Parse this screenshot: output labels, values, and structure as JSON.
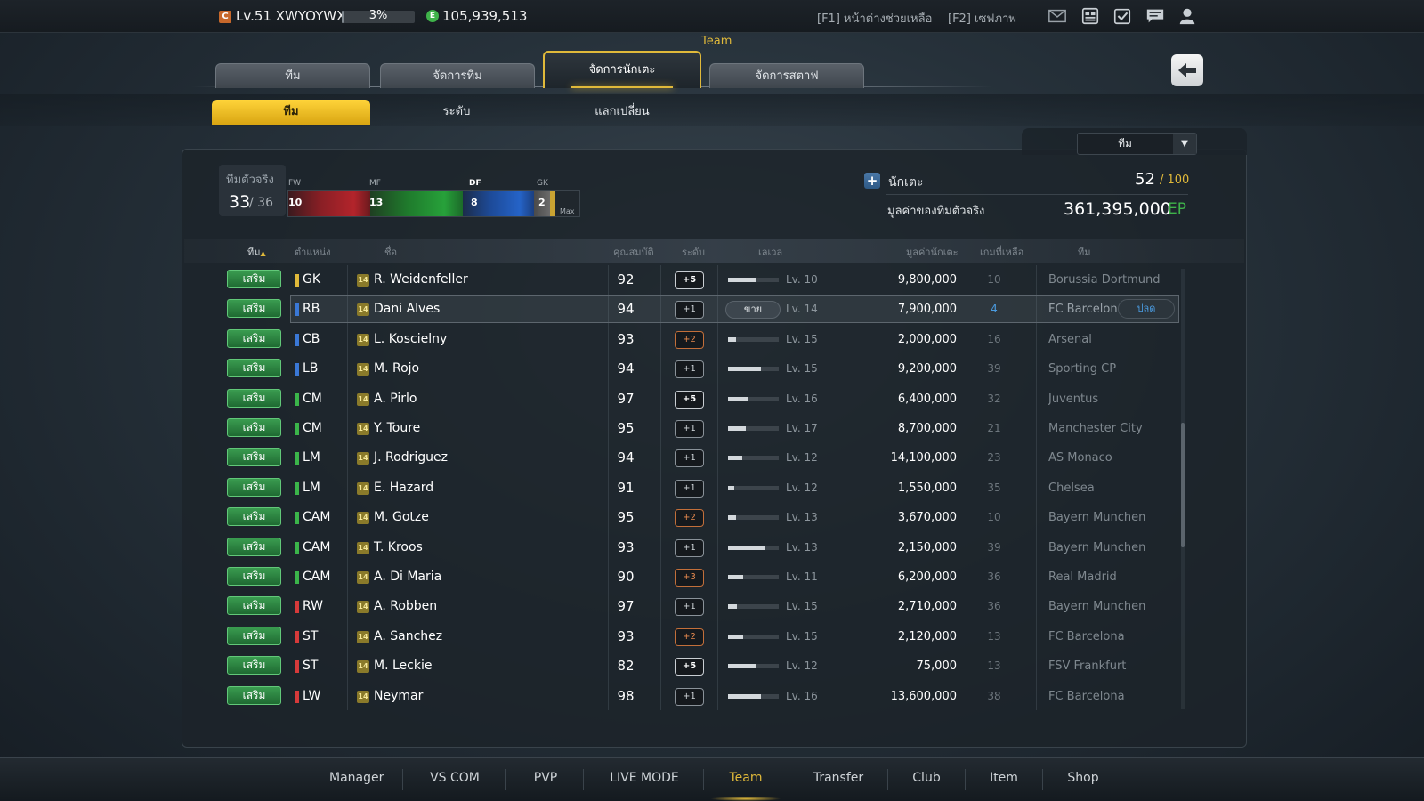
{
  "topbar": {
    "level_icon": "C",
    "level_text": "Lv.51 XWYOYWX",
    "exp_percent": "3%",
    "exp_fraction": 0.03,
    "ep_icon": "E",
    "ep_amount": "105,939,513",
    "help_text": "[F1] หน้าต่างช่วยเหลือ",
    "save_text": "[F2] เซฟภาพ",
    "icons": [
      "mail-icon",
      "card-icon",
      "checklist-icon",
      "message-icon",
      "user-icon"
    ]
  },
  "section_title": "Team",
  "main_tabs": [
    "ทีม",
    "จัดการทีม",
    "จัดการนักเตะ",
    "จัดการสตาฟ"
  ],
  "active_main_tab": "จัดการนักเตะ",
  "sub_tabs": [
    "ทีม",
    "ระดับ",
    "แลกเปลี่ยน"
  ],
  "active_sub_tab": "ทีม",
  "filter": {
    "selected": "ทีม"
  },
  "real_team": {
    "label": "ทีมตัวจริง",
    "count": "33",
    "total": "/ 36",
    "positions": [
      {
        "label": "FW",
        "count": "10"
      },
      {
        "label": "MF",
        "count": "13"
      },
      {
        "label": "DF",
        "count": "8"
      },
      {
        "label": "GK",
        "count": "2"
      }
    ],
    "max_label": "Max"
  },
  "players_summary": {
    "label": "นักเตะ",
    "count": "52",
    "max": "/ 100",
    "value_label": "มูลค่าของทีมตัวจริง",
    "value": "361,395,000",
    "value_unit": "EP"
  },
  "table": {
    "headers": {
      "team": "ทีม",
      "position": "ตำแหน่ง",
      "name": "ชื่อ",
      "ovr": "คุณสมบัติ",
      "grade": "ระดับ",
      "level": "เลเวล",
      "value": "มูลค่านักเตะ",
      "games": "เกมที่เหลือ",
      "club": "ทีม"
    },
    "start_label": "เสริม",
    "sell_label": "ขาย",
    "release_label": "ปลด",
    "card_badge": "14",
    "rows": [
      {
        "pos": "GK",
        "pos_color": "#e0b93a",
        "name": "R. Weidenfeller",
        "ovr": "92",
        "grade": "+5",
        "grade_style": "bright",
        "level_fill": 0.55,
        "level": "Lv. 10",
        "value": "9,800,000",
        "games": "10",
        "club": "Borussia Dortmund"
      },
      {
        "pos": "RB",
        "pos_color": "#3a78d6",
        "name": "Dani Alves",
        "ovr": "94",
        "grade": "+1",
        "grade_style": "normal",
        "level_fill": 0.4,
        "level": "Lv. 14",
        "value": "7,900,000",
        "games": "4",
        "club": "FC Barcelona",
        "selected": true
      },
      {
        "pos": "CB",
        "pos_color": "#3a78d6",
        "name": "L. Koscielny",
        "ovr": "93",
        "grade": "+2",
        "grade_style": "orange",
        "level_fill": 0.15,
        "level": "Lv. 15",
        "value": "2,000,000",
        "games": "16",
        "club": "Arsenal"
      },
      {
        "pos": "LB",
        "pos_color": "#3a78d6",
        "name": "M. Rojo",
        "ovr": "94",
        "grade": "+1",
        "grade_style": "normal",
        "level_fill": 0.65,
        "level": "Lv. 15",
        "value": "9,200,000",
        "games": "39",
        "club": "Sporting CP"
      },
      {
        "pos": "CM",
        "pos_color": "#3bb54a",
        "name": "A. Pirlo",
        "ovr": "97",
        "grade": "+5",
        "grade_style": "bright",
        "level_fill": 0.4,
        "level": "Lv. 16",
        "value": "6,400,000",
        "games": "32",
        "club": "Juventus"
      },
      {
        "pos": "CM",
        "pos_color": "#3bb54a",
        "name": "Y. Toure",
        "ovr": "95",
        "grade": "+1",
        "grade_style": "normal",
        "level_fill": 0.35,
        "level": "Lv. 17",
        "value": "8,700,000",
        "games": "21",
        "club": "Manchester City"
      },
      {
        "pos": "LM",
        "pos_color": "#3bb54a",
        "name": "J. Rodriguez",
        "ovr": "94",
        "grade": "+1",
        "grade_style": "normal",
        "level_fill": 0.28,
        "level": "Lv. 12",
        "value": "14,100,000",
        "games": "23",
        "club": "AS Monaco"
      },
      {
        "pos": "LM",
        "pos_color": "#3bb54a",
        "name": "E. Hazard",
        "ovr": "91",
        "grade": "+1",
        "grade_style": "normal",
        "level_fill": 0.12,
        "level": "Lv. 12",
        "value": "1,550,000",
        "games": "35",
        "club": "Chelsea"
      },
      {
        "pos": "CAM",
        "pos_color": "#3bb54a",
        "name": "M. Gotze",
        "ovr": "95",
        "grade": "+2",
        "grade_style": "orange",
        "level_fill": 0.15,
        "level": "Lv. 13",
        "value": "3,670,000",
        "games": "10",
        "club": "Bayern Munchen"
      },
      {
        "pos": "CAM",
        "pos_color": "#3bb54a",
        "name": "T. Kroos",
        "ovr": "93",
        "grade": "+1",
        "grade_style": "normal",
        "level_fill": 0.72,
        "level": "Lv. 13",
        "value": "2,150,000",
        "games": "39",
        "club": "Bayern Munchen"
      },
      {
        "pos": "CAM",
        "pos_color": "#3bb54a",
        "name": "A. Di Maria",
        "ovr": "90",
        "grade": "+3",
        "grade_style": "orange",
        "level_fill": 0.3,
        "level": "Lv. 11",
        "value": "6,200,000",
        "games": "36",
        "club": "Real Madrid"
      },
      {
        "pos": "RW",
        "pos_color": "#d63a3a",
        "name": "A. Robben",
        "ovr": "97",
        "grade": "+1",
        "grade_style": "normal",
        "level_fill": 0.18,
        "level": "Lv. 15",
        "value": "2,710,000",
        "games": "36",
        "club": "Bayern Munchen"
      },
      {
        "pos": "ST",
        "pos_color": "#d63a3a",
        "name": "A. Sanchez",
        "ovr": "93",
        "grade": "+2",
        "grade_style": "orange",
        "level_fill": 0.3,
        "level": "Lv. 15",
        "value": "2,120,000",
        "games": "13",
        "club": "FC Barcelona"
      },
      {
        "pos": "ST",
        "pos_color": "#d63a3a",
        "name": "M. Leckie",
        "ovr": "82",
        "grade": "+5",
        "grade_style": "bright",
        "level_fill": 0.55,
        "level": "Lv. 12",
        "value": "75,000",
        "games": "13",
        "club": "FSV Frankfurt"
      },
      {
        "pos": "LW",
        "pos_color": "#d63a3a",
        "name": "Neymar",
        "ovr": "98",
        "grade": "+1",
        "grade_style": "normal",
        "level_fill": 0.65,
        "level": "Lv. 16",
        "value": "13,600,000",
        "games": "38",
        "club": "FC Barcelona"
      }
    ]
  },
  "bottom_nav": [
    "Manager",
    "VS COM",
    "PVP",
    "LIVE MODE",
    "Team",
    "Transfer",
    "Club",
    "Item",
    "Shop"
  ],
  "active_nav": "Team",
  "colors": {
    "accent": "#e0b93a",
    "ep_green": "#3fb34a",
    "link_blue": "#4a9be0"
  }
}
